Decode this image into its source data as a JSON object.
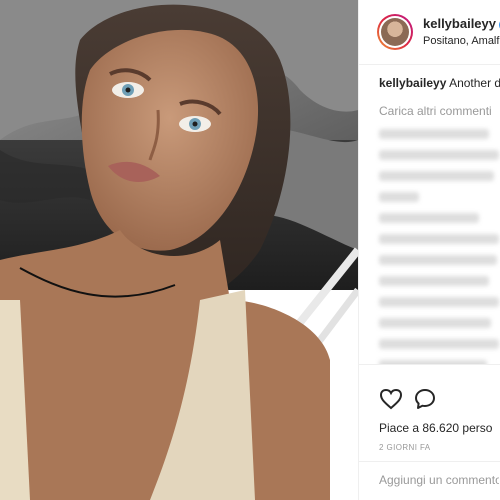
{
  "post": {
    "username": "kellybaileyy",
    "location": "Positano, Amalfi C",
    "caption_username": "kellybaileyy",
    "caption_text": "Another da",
    "load_more_label": "Carica altri commenti",
    "likes_label": "Piace a 86.620 perso",
    "time_label": "2 GIORNI FA",
    "comment_placeholder": "Aggiungi un commento"
  },
  "colors": {
    "verified": "#3897f0",
    "text": "#262626",
    "muted": "#999999"
  },
  "icons": {
    "like": "heart-icon",
    "comment": "comment-bubble-icon",
    "verified": "verified-badge-icon"
  }
}
